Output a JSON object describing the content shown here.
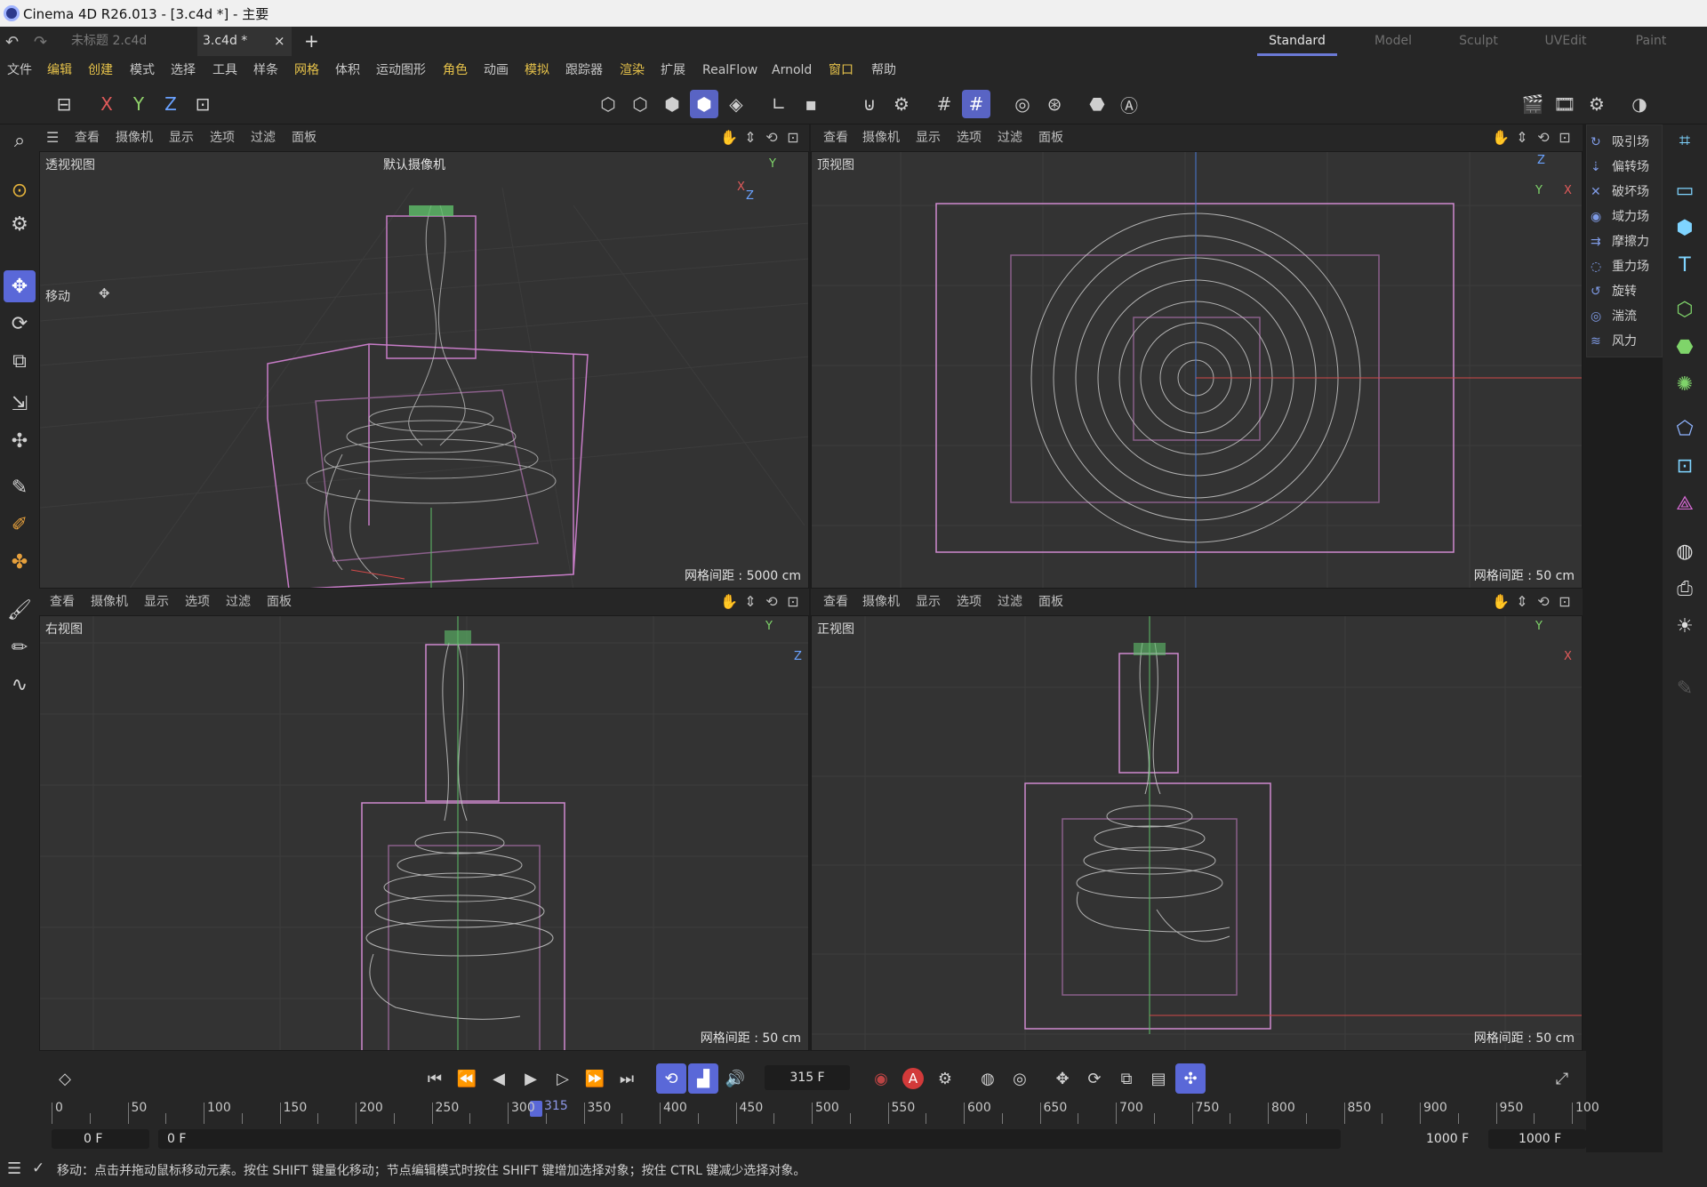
{
  "window": {
    "title": "Cinema 4D R26.013 - [3.c4d *] - 主要"
  },
  "tabs": [
    {
      "label": "未标题 2.c4d"
    },
    {
      "label": "3.c4d *"
    }
  ],
  "tab_close": "×",
  "tab_add": "+",
  "layouts": [
    "Standard",
    "Model",
    "Sculpt",
    "UVEdit",
    "Paint"
  ],
  "menu": [
    "文件",
    "编辑",
    "创建",
    "模式",
    "选择",
    "工具",
    "样条",
    "网格",
    "体积",
    "运动图形",
    "角色",
    "动画",
    "模拟",
    "跟踪器",
    "渲染",
    "扩展",
    "RealFlow",
    "Arnold",
    "窗口",
    "帮助"
  ],
  "toolbar": {
    "x": "X",
    "y": "Y",
    "z": "Z"
  },
  "viewport_menu": [
    "查看",
    "摄像机",
    "显示",
    "选项",
    "过滤",
    "面板"
  ],
  "viewports": {
    "perspective": {
      "label": "透视视图",
      "camera": "默认摄像机",
      "grid": "网格间距 : 5000 cm",
      "move_label": "移动"
    },
    "top": {
      "label": "顶视图",
      "grid": "网格间距 : 50 cm"
    },
    "right": {
      "label": "右视图",
      "grid": "网格间距 : 50 cm"
    },
    "front": {
      "label": "正视图",
      "grid": "网格间距 : 50 cm"
    }
  },
  "axes": {
    "x": "X",
    "y": "Y",
    "z": "Z"
  },
  "forces": [
    "吸引场",
    "偏转场",
    "破坏场",
    "域力场",
    "摩擦力",
    "重力场",
    "旋转",
    "湍流",
    "风力"
  ],
  "timeline": {
    "current_frame": "315 F",
    "playhead_label": "315",
    "ruler": [
      "0",
      "50",
      "100",
      "150",
      "200",
      "250",
      "300",
      "350",
      "400",
      "450",
      "500",
      "550",
      "600",
      "650",
      "700",
      "750",
      "800",
      "850",
      "900",
      "950",
      "100"
    ],
    "start": "0 F",
    "start2": "0 F",
    "end": "1000 F",
    "end2": "1000 F"
  },
  "status": {
    "text": "移动：点击并拖动鼠标移动元素。按住 SHIFT 键量化移动；节点编辑模式时按住 SHIFT 键增加选择对象；按住 CTRL 键减少选择对象。"
  }
}
